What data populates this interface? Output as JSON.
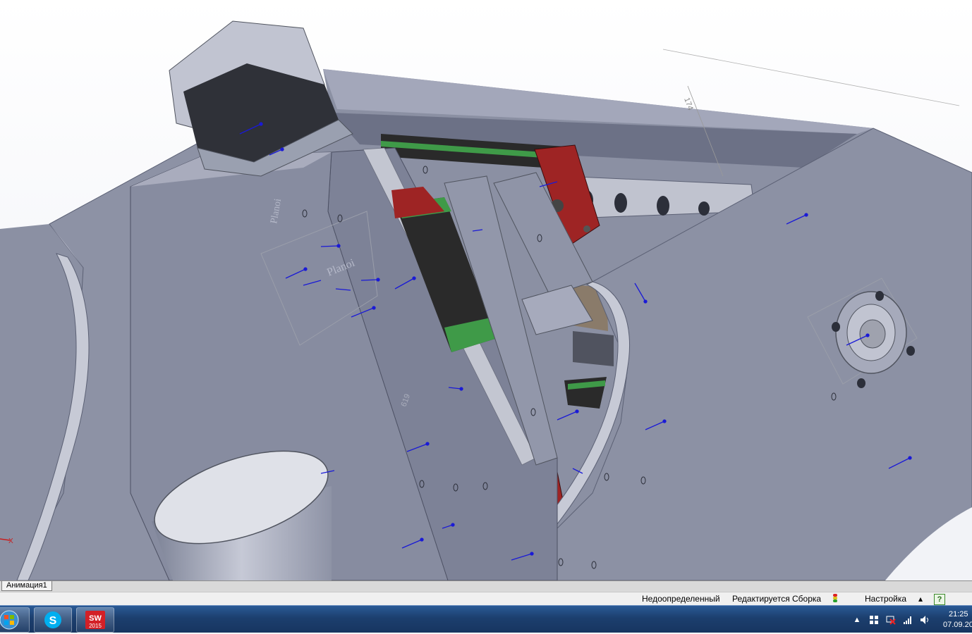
{
  "viewport": {
    "dimension_top": "174",
    "dimension_side": "619",
    "engraving_1": "Planoi",
    "engraving_2": "Planoi",
    "triad_x_label": "X",
    "colors": {
      "body_plate": "#8b90a3",
      "plate_dark": "#6c7186",
      "plate_light": "#a3a7ba",
      "rail_green": "#3f9a48",
      "carriage_black": "#2a2a2a",
      "block_red": "#9e2424",
      "annotation_blue": "#1a1ad6"
    }
  },
  "animation_tab": {
    "label": "Анимация1"
  },
  "statusbar": {
    "definition_status": "Недоопределенный",
    "edit_status": "Редактируется Сборка",
    "settings_label": "Настройка",
    "settings_arrow": "▴",
    "help_label": "?"
  },
  "taskbar": {
    "apps": [
      {
        "name": "start",
        "icon": "windows-orb-icon"
      },
      {
        "name": "skype",
        "icon": "skype-icon",
        "glyph": "S"
      },
      {
        "name": "solidworks",
        "icon": "solidworks-2015-icon",
        "glyph": "SW",
        "version": "2015"
      }
    ],
    "tray": {
      "show_hidden": "▲",
      "time": "21:25",
      "date": "07.09.20"
    }
  }
}
